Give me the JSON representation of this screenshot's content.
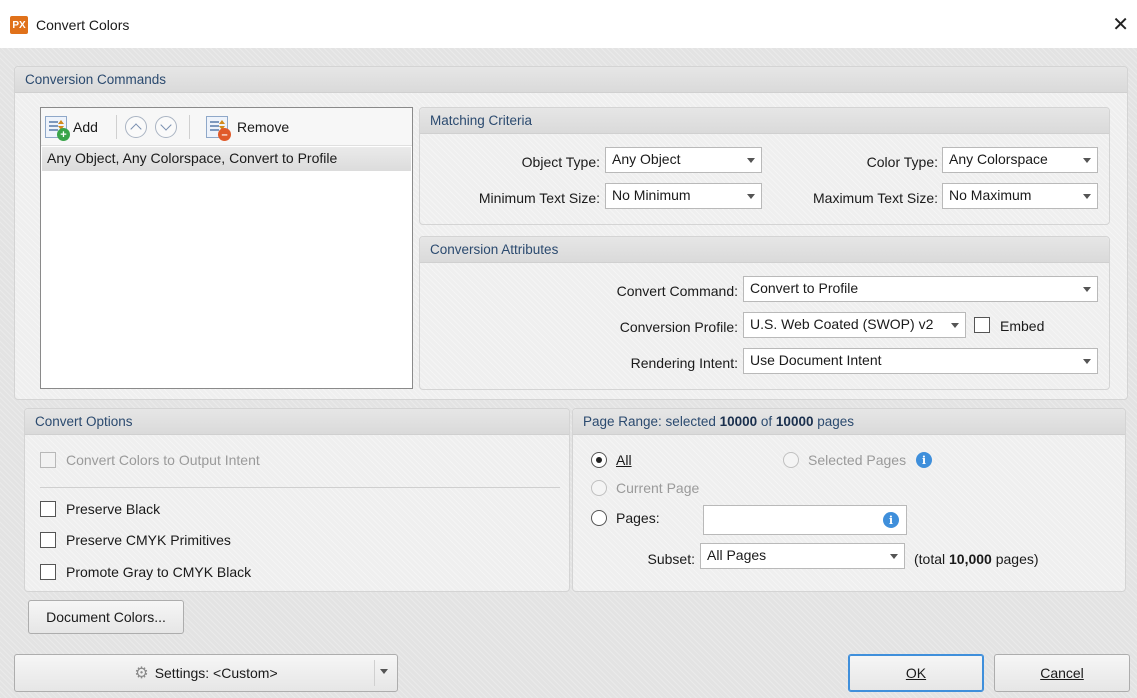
{
  "window": {
    "title": "Convert Colors",
    "app_icon_text": "PX",
    "close_glyph": "✕"
  },
  "conversion_commands": {
    "header": "Conversion Commands",
    "toolbar": {
      "add_label": "Add",
      "remove_label": "Remove"
    },
    "list_items": [
      "Any Object, Any Colorspace, Convert to Profile"
    ]
  },
  "matching_criteria": {
    "header": "Matching Criteria",
    "object_type_label": "Object Type:",
    "object_type_value": "Any Object",
    "color_type_label": "Color Type:",
    "color_type_value": "Any Colorspace",
    "min_text_size_label": "Minimum Text Size:",
    "min_text_size_value": "No Minimum",
    "max_text_size_label": "Maximum Text Size:",
    "max_text_size_value": "No Maximum"
  },
  "conversion_attributes": {
    "header": "Conversion Attributes",
    "convert_command_label": "Convert Command:",
    "convert_command_value": "Convert to Profile",
    "conversion_profile_label": "Conversion Profile:",
    "conversion_profile_value": "U.S. Web Coated (SWOP) v2",
    "embed_label": "Embed",
    "rendering_intent_label": "Rendering Intent:",
    "rendering_intent_value": "Use Document Intent"
  },
  "convert_options": {
    "header": "Convert Options",
    "output_intent_label": "Convert Colors to Output Intent",
    "preserve_black_label": "Preserve Black",
    "preserve_cmyk_label": "Preserve CMYK Primitives",
    "promote_gray_label": "Promote Gray to CMYK Black"
  },
  "page_range": {
    "header_prefix": "Page Range: selected ",
    "selected_count": "10000",
    "header_mid": " of ",
    "total_count": "10000",
    "header_suffix": " pages",
    "all_label": "All",
    "selected_pages_label": "Selected Pages",
    "current_page_label": "Current Page",
    "pages_label": "Pages:",
    "pages_value": "",
    "subset_label": "Subset:",
    "subset_value": "All Pages",
    "total_prefix": "(total ",
    "total_value": "10,000",
    "total_suffix": " pages)"
  },
  "buttons": {
    "document_colors": "Document Colors...",
    "settings": "Settings: <Custom>",
    "ok": "OK",
    "cancel": "Cancel"
  },
  "colors": {
    "header_text": "#2b4a6f",
    "info_blue": "#3f8fdb",
    "add_badge": "#3aa44a",
    "remove_badge": "#e05a2a"
  }
}
